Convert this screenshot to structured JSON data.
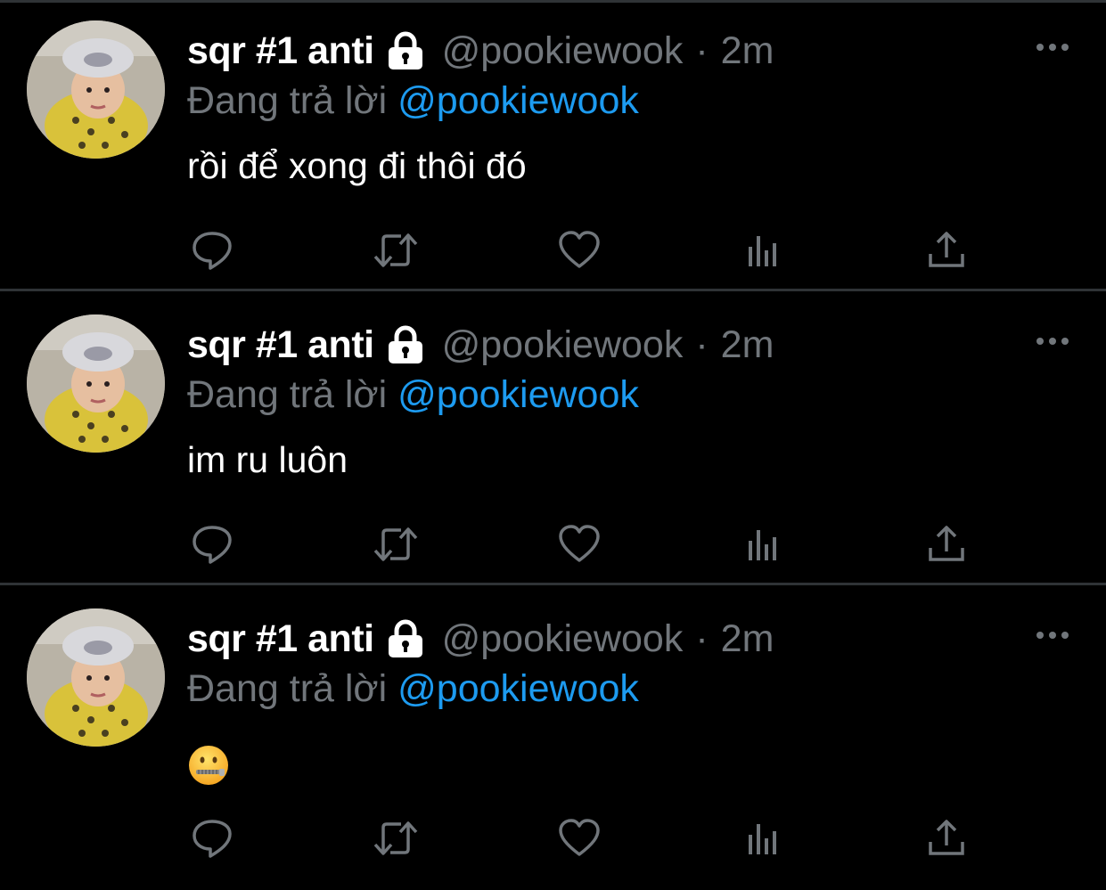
{
  "tweets": [
    {
      "name": "sqr #1 anti",
      "handle": "@pookiewook",
      "separator": "·",
      "time": "2m",
      "replying_prefix": "Đang trả lời",
      "replying_to": "@pookiewook",
      "text": "rồi để xong đi thôi đó"
    },
    {
      "name": "sqr #1 anti",
      "handle": "@pookiewook",
      "separator": "·",
      "time": "2m",
      "replying_prefix": "Đang trả lời",
      "replying_to": "@pookiewook",
      "text": "im ru luôn"
    },
    {
      "name": "sqr #1 anti",
      "handle": "@pookiewook",
      "separator": "·",
      "time": "2m",
      "replying_prefix": "Đang trả lời",
      "replying_to": "@pookiewook",
      "text": "",
      "emoji": "zipper-mouth-face"
    }
  ],
  "icons": {
    "lock": "lock-icon",
    "more": "more-horizontal-icon",
    "reply": "reply-icon",
    "retweet": "retweet-icon",
    "like": "heart-icon",
    "views": "views-chart-icon",
    "share": "share-icon"
  },
  "colors": {
    "background": "#000000",
    "name": "#ffffff",
    "secondary": "#71767b",
    "mention": "#1d9bf0",
    "divider": "#2f3336"
  }
}
